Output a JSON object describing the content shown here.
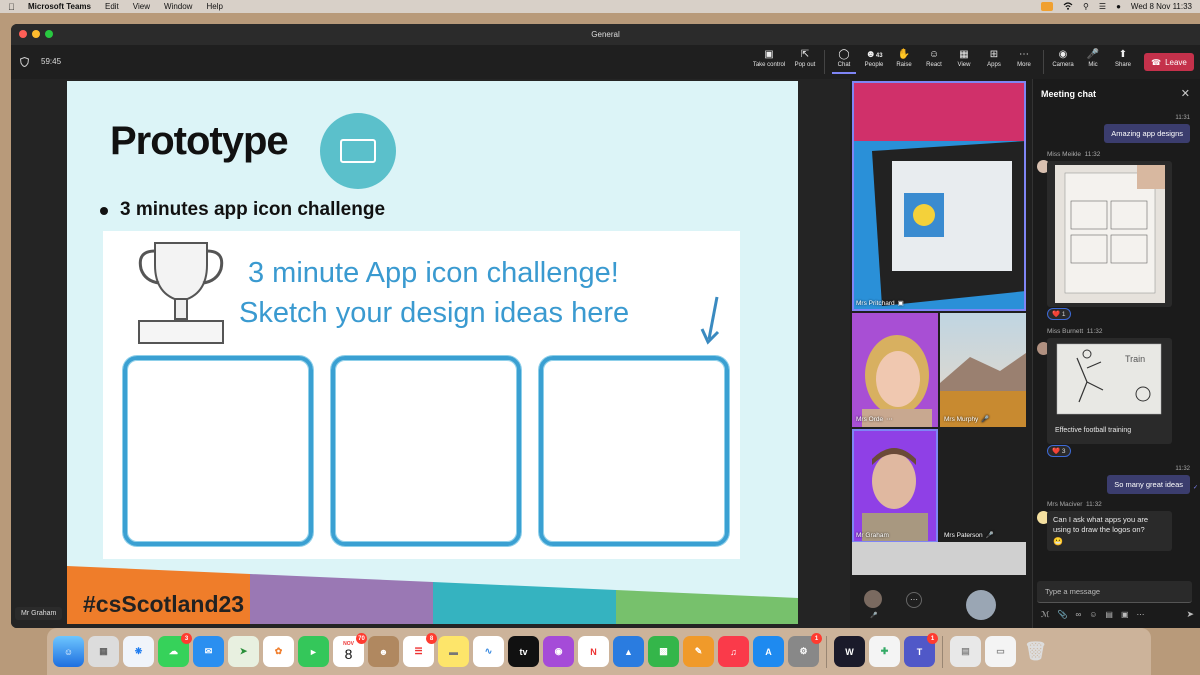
{
  "menubar": {
    "app_name": "Microsoft Teams",
    "menus": [
      "Edit",
      "View",
      "Window",
      "Help"
    ],
    "datetime": "Wed 8 Nov  11:33"
  },
  "window": {
    "title": "General",
    "timer": "59:45"
  },
  "toolbar": {
    "take_control": "Take control",
    "pop_out": "Pop out",
    "chat": "Chat",
    "people_count": "43",
    "people": "People",
    "raise": "Raise",
    "react": "React",
    "view": "View",
    "apps": "Apps",
    "more": "More",
    "camera": "Camera",
    "mic": "Mic",
    "share": "Share",
    "leave": "Leave"
  },
  "slide": {
    "title": "Prototype",
    "bullet": "3 minutes app icon challenge",
    "heading_line1": "3 minute App icon challenge!",
    "heading_line2": "Sketch your design ideas here",
    "hashtag": "#csScotland23"
  },
  "presenter_label": "Mr Graham",
  "participants": [
    {
      "name": "Mrs Pritchard"
    },
    {
      "name": "Mrs Orde"
    },
    {
      "name": "Mrs Murphy"
    },
    {
      "name": "Mr Graham"
    },
    {
      "name": "Mrs Paterson"
    }
  ],
  "chat": {
    "title": "Meeting chat",
    "messages": [
      {
        "time": "11:31",
        "text": "Amazing app designs"
      },
      {
        "sender": "Miss Meikle",
        "time": "11:32",
        "reaction": "1"
      },
      {
        "sender": "Miss Burnett",
        "time": "11:32",
        "caption": "Effective football training",
        "reaction": "3",
        "image_text": "Train"
      },
      {
        "time": "11:32",
        "text": "So many great ideas"
      },
      {
        "sender": "Mrs Maciver",
        "time": "11:32",
        "text_line1": "Can I ask what apps you are",
        "text_line2": "using to draw the logos on?"
      }
    ],
    "compose_placeholder": "Type a message"
  },
  "dock": {
    "messages_badge": "3",
    "calendar_month": "NOV",
    "calendar_day": "8",
    "calendar_badge": "70",
    "reminders_badge": "8",
    "settings_badge": "1",
    "teams_badge": "1"
  }
}
